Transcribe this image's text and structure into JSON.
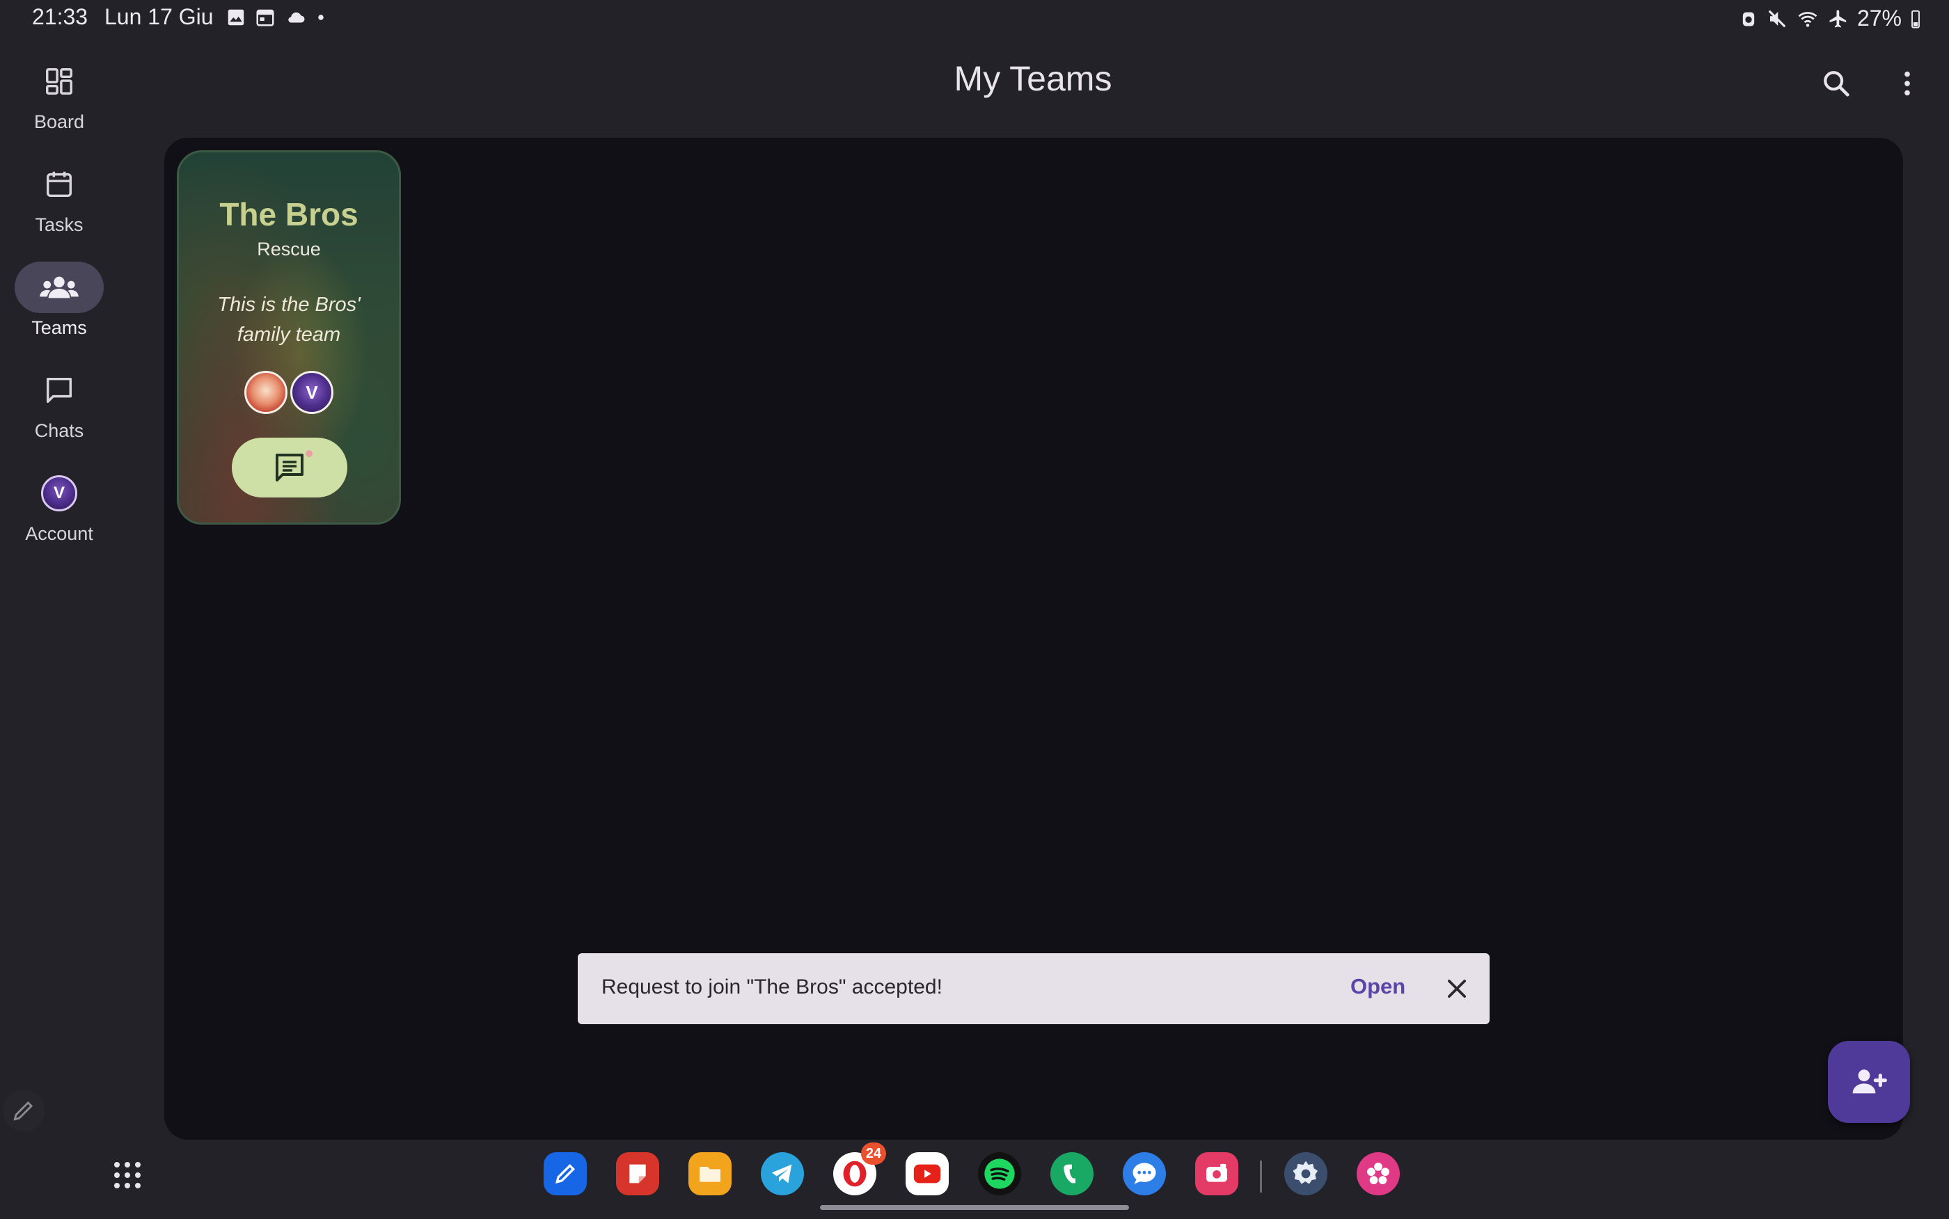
{
  "status_bar": {
    "time": "21:33",
    "date": "Lun 17 Giu",
    "battery": "27%",
    "left_icons": [
      "gallery-icon",
      "calendar-icon",
      "cloud-icon",
      "dot-icon"
    ],
    "right_icons": [
      "alarm-icon",
      "mute-icon",
      "wifi-icon",
      "airplane-icon"
    ]
  },
  "app_bar": {
    "title": "My Teams",
    "actions": [
      "search-icon",
      "more-vert-icon"
    ]
  },
  "nav_rail": {
    "items": [
      {
        "label": "Board",
        "icon": "dashboard-icon"
      },
      {
        "label": "Tasks",
        "icon": "calendar-icon"
      },
      {
        "label": "Teams",
        "icon": "groups-icon",
        "active": true
      },
      {
        "label": "Chats",
        "icon": "chat-bubble-icon"
      },
      {
        "label": "Account",
        "icon": "avatar"
      }
    ]
  },
  "team_card": {
    "name": "The Bros",
    "category": "Rescue",
    "description": "This is the Bros' family team",
    "member_count": 2
  },
  "snackbar": {
    "message": "Request to join \"The Bros\" accepted!",
    "action": "Open"
  },
  "fab": {
    "icon": "person-add-icon"
  },
  "taskbar": {
    "apps": [
      {
        "name": "pen-app",
        "color": "#1766e6"
      },
      {
        "name": "notes-app",
        "color": "#d7352b"
      },
      {
        "name": "files-app",
        "color": "#f2a51c"
      },
      {
        "name": "telegram-app",
        "color": "#2aa3dc"
      },
      {
        "name": "opera-app",
        "color": "#ffffff",
        "badge": "24"
      },
      {
        "name": "youtube-app",
        "color": "#ffffff"
      },
      {
        "name": "spotify-app",
        "color": "#111111"
      },
      {
        "name": "phone-app",
        "color": "#1aa865"
      },
      {
        "name": "messages-app",
        "color": "#2e7ee8"
      },
      {
        "name": "screen-recorder-app",
        "color": "#e43a66"
      },
      {
        "name": "settings-app",
        "color": "#3c4e6e"
      },
      {
        "name": "bixby-app",
        "color": "#e03a86"
      }
    ]
  }
}
